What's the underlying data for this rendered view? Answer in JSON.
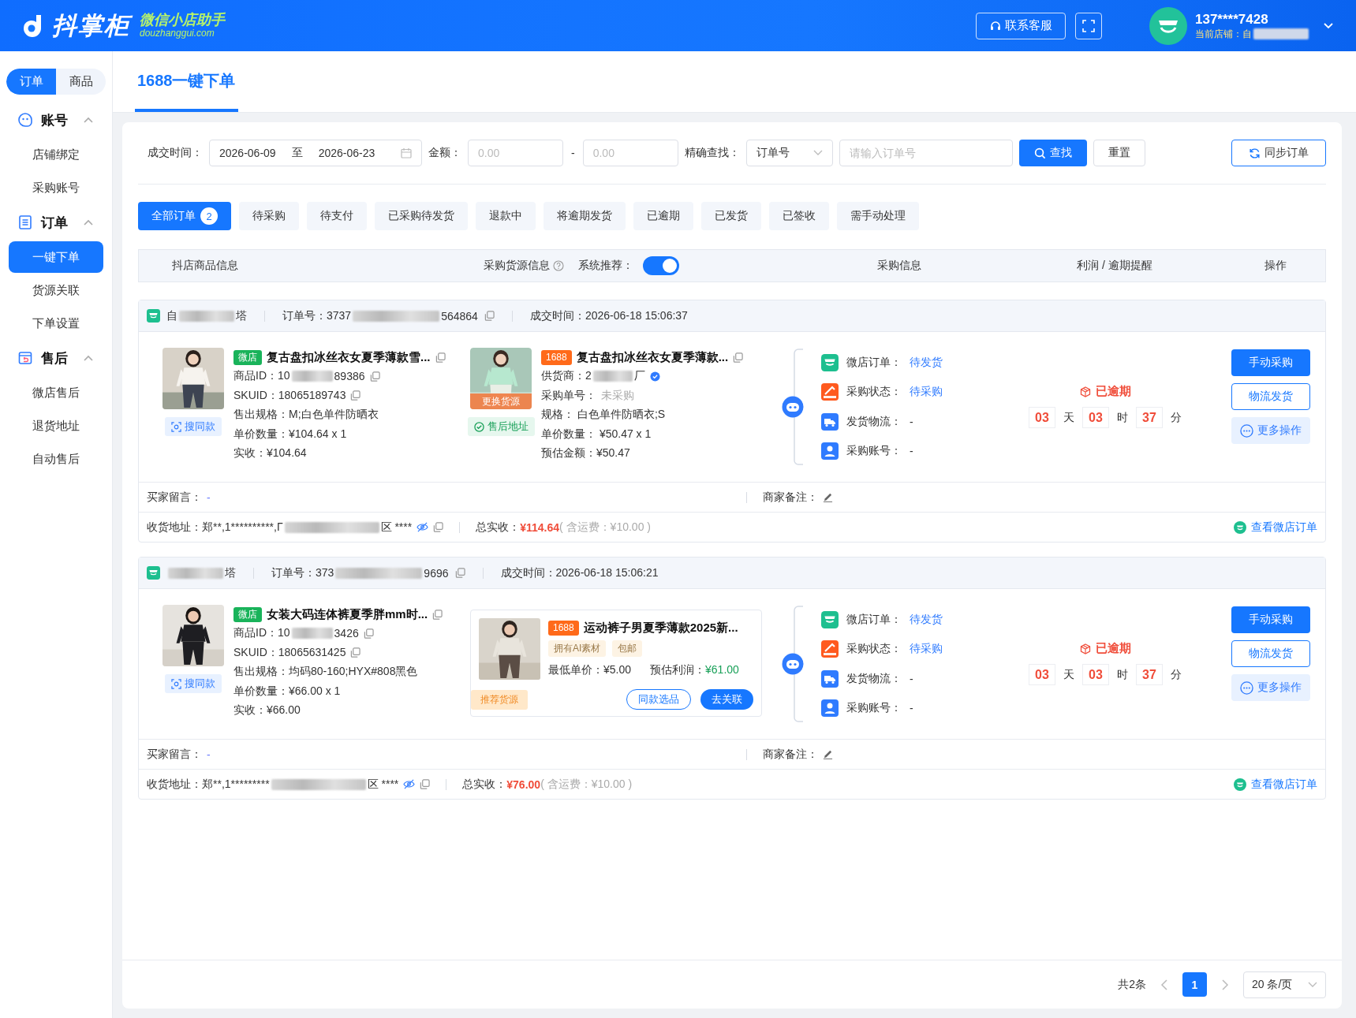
{
  "header": {
    "logo_text": "抖掌柜",
    "logo_subtitle": "微信小店助手",
    "logo_domain": "douzhanggui.com",
    "support_button": "联系客服",
    "account": "137****7428",
    "store_label": "当前店铺：",
    "store_prefix": "自"
  },
  "sidebar": {
    "segments": [
      {
        "label": "订单",
        "selected": true
      },
      {
        "label": "商品",
        "selected": false
      }
    ],
    "groups": [
      {
        "title": "账号",
        "expanded": true,
        "items": [
          {
            "label": "店铺绑定",
            "selected": false
          },
          {
            "label": "采购账号",
            "selected": false
          }
        ]
      },
      {
        "title": "订单",
        "expanded": true,
        "items": [
          {
            "label": "一键下单",
            "selected": true
          },
          {
            "label": "货源关联",
            "selected": false
          },
          {
            "label": "下单设置",
            "selected": false
          }
        ]
      },
      {
        "title": "售后",
        "expanded": true,
        "items": [
          {
            "label": "微店售后",
            "selected": false
          },
          {
            "label": "退货地址",
            "selected": false
          },
          {
            "label": "自动售后",
            "selected": false
          }
        ]
      }
    ]
  },
  "page_tabs": [
    {
      "label": "1688一键下单",
      "selected": true
    }
  ],
  "filters": {
    "date_label": "成交时间：",
    "date_start": "2026-06-09",
    "date_sep": "至",
    "date_end": "2026-06-23",
    "amount_label": "金额：",
    "amount_min_placeholder": "0.00",
    "amount_sep": "-",
    "amount_max_placeholder": "0.00",
    "exact_label": "精确查找：",
    "exact_field": "订单号",
    "search_placeholder": "请输入订单号",
    "search_button": "查找",
    "reset_button": "重置",
    "sync_button": "同步订单"
  },
  "status_tabs": [
    {
      "label": "全部订单",
      "count": "2",
      "selected": true
    },
    {
      "label": "待采购",
      "selected": false
    },
    {
      "label": "待支付",
      "selected": false
    },
    {
      "label": "已采购待发货",
      "selected": false
    },
    {
      "label": "退款中",
      "selected": false
    },
    {
      "label": "将逾期发货",
      "selected": false
    },
    {
      "label": "已逾期",
      "selected": false
    },
    {
      "label": "已发货",
      "selected": false
    },
    {
      "label": "已签收",
      "selected": false
    },
    {
      "label": "需手动处理",
      "selected": false
    }
  ],
  "table_header": {
    "columns": [
      "抖店商品信息",
      "采购货源信息",
      "采购信息",
      "利润 / 逾期提醒",
      "操作"
    ],
    "recommend_label": "系统推荐：",
    "recommend_on": true
  },
  "orders": [
    {
      "store_prefix": "自",
      "store_suffix": "塔",
      "order_no_label": "订单号：",
      "order_no_prefix": "3737",
      "order_no_suffix": "564864",
      "time_label": "成交时间：",
      "time": "2026-06-18 15:06:37",
      "product": {
        "channel": "微店",
        "title": "复古盘扣冰丝衣女夏季薄款雪...",
        "id_label": "商品ID：",
        "id_prefix": "10",
        "id_suffix": "89386",
        "sku": "SKUID：18065189743",
        "spec": "售出规格：M;白色单件防晒衣",
        "price_qty": "单价数量：¥104.64 x 1",
        "received": "实收：¥104.64",
        "similar_button": "搜同款"
      },
      "source": {
        "kind": "linked",
        "badge": "1688",
        "title": "复古盘扣冰丝衣女夏季薄款...",
        "picture_caption": "更换货源",
        "after_sale": "售后地址",
        "supplier_label": "供货商：",
        "supplier_prefix": "2",
        "supplier_suffix": "厂",
        "purchase_no_label": "采购单号：",
        "purchase_no": "未采购",
        "spec": "规格：  白色单件防晒衣;S",
        "price_qty": "单价数量：  ¥50.47 x 1",
        "estimate": "预估金额：¥50.47"
      },
      "purchase": [
        {
          "label": "微店订单：",
          "value": "待发货",
          "link": true
        },
        {
          "label": "采购状态：",
          "value": "待采购",
          "link": true
        },
        {
          "label": "发货物流：",
          "value": "-",
          "link": false
        },
        {
          "label": "采购账号：",
          "value": "-",
          "link": false
        }
      ],
      "overdue": {
        "label": "已逾期",
        "days": "03",
        "day_unit": "天",
        "hours": "03",
        "hour_unit": "时",
        "minutes": "37",
        "minute_unit": "分"
      },
      "actions": [
        {
          "kind": "primary",
          "label": "手动采购"
        },
        {
          "kind": "outline",
          "label": "物流发货"
        },
        {
          "kind": "more",
          "label": "更多操作"
        }
      ],
      "buyer_note_label": "买家留言：",
      "buyer_note": "-",
      "merchant_note_label": "商家备注：",
      "address_label": "收货地址：",
      "address_prefix": "郑**,1**********,Г",
      "address_suffix": "区 ****",
      "total_label": "总实收：",
      "total": "¥114.64",
      "shipping": "( 含运费：¥10.00 )",
      "view_link": "查看微店订单"
    },
    {
      "store_suffix": "塔",
      "order_no_label": "订单号：",
      "order_no_prefix": "373",
      "order_no_suffix": "9696",
      "time_label": "成交时间：",
      "time": "2026-06-18 15:06:21",
      "product": {
        "channel": "微店",
        "title": "女装大码连体裤夏季胖mm时...",
        "id_label": "商品ID：",
        "id_prefix": "10",
        "id_suffix": "3426",
        "sku": "SKUID：18065631425",
        "spec": "售出规格：均码80-160;HYX#808黑色",
        "price_qty": "单价数量：¥66.00 x 1",
        "received": "实收：¥66.00",
        "similar_button": "搜同款"
      },
      "source": {
        "kind": "recommended",
        "badge": "1688",
        "title": "运动裤子男夏季薄款2025新...",
        "tags": [
          "拥有AI素材",
          "包邮"
        ],
        "min_price_label": "最低单价：",
        "min_price": "¥5.00",
        "profit_label": "预估利润：",
        "profit": "¥61.00",
        "ribbon": "推荐货源",
        "buttons": [
          "同款选品",
          "去关联"
        ]
      },
      "purchase": [
        {
          "label": "微店订单：",
          "value": "待发货",
          "link": true
        },
        {
          "label": "采购状态：",
          "value": "待采购",
          "link": true
        },
        {
          "label": "发货物流：",
          "value": "-",
          "link": false
        },
        {
          "label": "采购账号：",
          "value": "-",
          "link": false
        }
      ],
      "overdue": {
        "label": "已逾期",
        "days": "03",
        "day_unit": "天",
        "hours": "03",
        "hour_unit": "时",
        "minutes": "37",
        "minute_unit": "分"
      },
      "actions": [
        {
          "kind": "primary",
          "label": "手动采购"
        },
        {
          "kind": "outline",
          "label": "物流发货"
        },
        {
          "kind": "more",
          "label": "更多操作"
        }
      ],
      "buyer_note_label": "买家留言：",
      "buyer_note": "-",
      "merchant_note_label": "商家备注：",
      "address_label": "收货地址：",
      "address_prefix": "郑**,1*********",
      "address_suffix": "区 ****",
      "total_label": "总实收：",
      "total": "¥76.00",
      "shipping": "( 含运费：¥10.00 )",
      "view_link": "查看微店订单"
    }
  ],
  "pagination": {
    "total": "共2条",
    "pages": [
      {
        "label": "1",
        "selected": true
      }
    ],
    "page_size": "20 条/页"
  }
}
